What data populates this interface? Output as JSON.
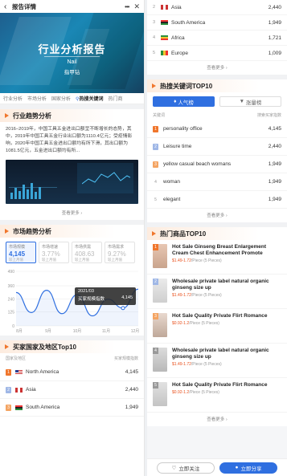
{
  "header": {
    "title": "报告详情"
  },
  "hero": {
    "title": "行业分析报告",
    "name": "Nail",
    "site": "指甲钻"
  },
  "tabs": [
    "行业分析",
    "市场分析",
    "国家分析",
    "热搜关键词",
    "热门商"
  ],
  "industry": {
    "section_title": "行业趋势分析",
    "paragraph": "2016–2019年，中国工具五金进出口额呈不断增长的态势，其中，2019年中国工具五金行业出口额为1110.4亿元；受疫情影响，2020年中国工具五金进出口额均有所下滑，其出口额为1081.5亿元，五金进出口额均有所...",
    "view_more": "查看更多"
  },
  "market": {
    "section_title": "市场趋势分析",
    "metrics": [
      {
        "label": "市场规模",
        "value": "4,145",
        "sub": "较上月值"
      },
      {
        "label": "市场增速",
        "value": "3.77%",
        "sub": "较上月值"
      },
      {
        "label": "市场供需",
        "value": "408.63",
        "sub": "较上月值"
      },
      {
        "label": "市场需求",
        "value": "9.27%",
        "sub": "较上月值"
      }
    ],
    "tooltip": {
      "date": "2021/03",
      "label": "买家规模指数",
      "value": "4,145"
    }
  },
  "chart_data": {
    "type": "area",
    "categories": [
      "8月",
      "9月",
      "10月",
      "11月",
      "12月"
    ],
    "values": [
      300,
      120,
      320,
      110,
      280,
      90,
      240,
      160,
      330
    ],
    "series": [
      {
        "values": [
          300,
          120,
          320,
          110,
          280,
          90,
          240,
          160,
          330
        ]
      }
    ],
    "y_ticks": [
      "0",
      "125",
      "240",
      "360",
      "490"
    ],
    "ylim": [
      0,
      490
    ]
  },
  "buyers": {
    "section_title": "买家国家及地区Top10",
    "col_left": "国家及地区",
    "col_right": "买家规模指数",
    "rows": [
      {
        "rank": "1",
        "name": "North America",
        "value": "4,145"
      },
      {
        "rank": "2",
        "name": "Asia",
        "value": "2,440"
      },
      {
        "rank": "3",
        "name": "South America",
        "value": "1,949"
      }
    ]
  },
  "right_top": {
    "rows": [
      {
        "rank": "2",
        "name": "Asia",
        "value": "2,440"
      },
      {
        "rank": "3",
        "name": "South America",
        "value": "1,949"
      },
      {
        "rank": "4",
        "name": "Africa",
        "value": "1,721"
      },
      {
        "rank": "5",
        "name": "Europe",
        "value": "1,009"
      }
    ],
    "view_more": "查看更多"
  },
  "keywords": {
    "section_title": "热搜关键词TOP10",
    "tab_hot": "人气榜",
    "tab_rise": "涨量榜",
    "col_left": "关键词",
    "col_right": "搜索买家指数",
    "rows": [
      {
        "rank": "1",
        "name": "personality office",
        "value": "4,145"
      },
      {
        "rank": "2",
        "name": "Leisure time",
        "value": "2,440"
      },
      {
        "rank": "3",
        "name": "yellow casual beach womans",
        "value": "1,949"
      },
      {
        "rank": "4",
        "name": "woman",
        "value": "1,949"
      },
      {
        "rank": "5",
        "name": "elegant",
        "value": "1,949"
      }
    ],
    "view_more": "查看更多"
  },
  "products": {
    "section_title": "热门商品TOP10",
    "rows": [
      {
        "rank": "1",
        "title": "Hot Sale Ginseng Breast Enlargement Cream Chest Enhancement Promote",
        "price": "$1.49-1.72",
        "unit": "/Piece",
        "min": "(5 Pieces)"
      },
      {
        "rank": "2",
        "title": "Wholesale private label natural organic ginseng size up",
        "price": "$1.49-1.72",
        "unit": "/Piece",
        "min": "(5 Pieces)"
      },
      {
        "rank": "3",
        "title": "Hot Sale Quality Private Flirt Romance",
        "price": "$0.92-1.2",
        "unit": "/Piece",
        "min": "(5 Pieces)"
      },
      {
        "rank": "4",
        "title": "Wholesale private label natural organic ginseng size up",
        "price": "$1.49-1.72",
        "unit": "/Piece",
        "min": "(5 Pieces)"
      },
      {
        "rank": "5",
        "title": "Hot Sale Quality Private Flirt Romance",
        "price": "$0.92-1.2",
        "unit": "/Piece",
        "min": "(5 Pieces)"
      }
    ],
    "view_more": "查看更多"
  },
  "bottom": {
    "follow": "立即关注",
    "share": "立即分享"
  },
  "colors": {
    "accent": "#2f6fe0",
    "orange": "#f0762c"
  }
}
